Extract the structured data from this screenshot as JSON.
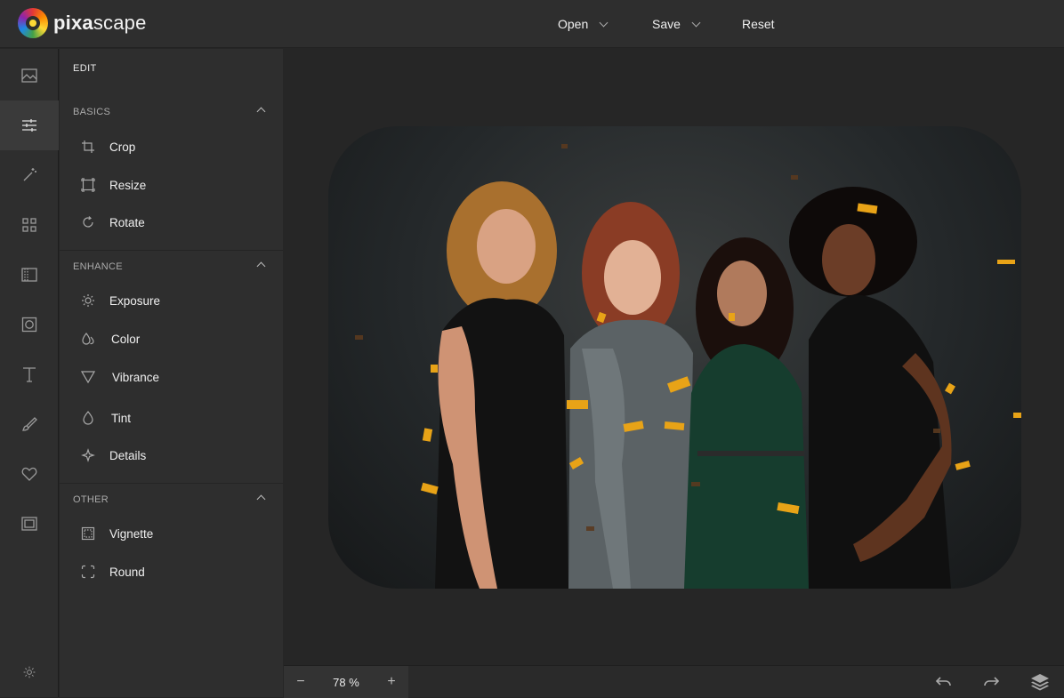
{
  "app": {
    "logo_part1": "pixa",
    "logo_part2": "scape"
  },
  "topmenu": {
    "open": "Open",
    "save": "Save",
    "reset": "Reset"
  },
  "rail": [
    {
      "icon": "image-icon"
    },
    {
      "icon": "sliders-icon",
      "active": true
    },
    {
      "icon": "magic-wand-icon"
    },
    {
      "icon": "grid-icon"
    },
    {
      "icon": "texture-icon"
    },
    {
      "icon": "frame-icon"
    },
    {
      "icon": "text-icon"
    },
    {
      "icon": "brush-icon"
    },
    {
      "icon": "heart-icon"
    },
    {
      "icon": "overlay-icon"
    },
    {
      "icon": "settings-icon"
    }
  ],
  "panel": {
    "title": "EDIT",
    "sections": [
      {
        "title": "BASICS",
        "items": [
          "Crop",
          "Resize",
          "Rotate"
        ]
      },
      {
        "title": "ENHANCE",
        "items": [
          "Exposure",
          "Color",
          "Vibrance",
          "Tint",
          "Details"
        ]
      },
      {
        "title": "OTHER",
        "items": [
          "Vignette",
          "Round"
        ]
      }
    ]
  },
  "zoom": {
    "value": "78 %",
    "minus": "−",
    "plus": "+"
  },
  "colors": {
    "topbar": "#2e2e2e",
    "panel": "#2e2e2e",
    "canvas": "#262626",
    "confetti": "#e8a317"
  }
}
